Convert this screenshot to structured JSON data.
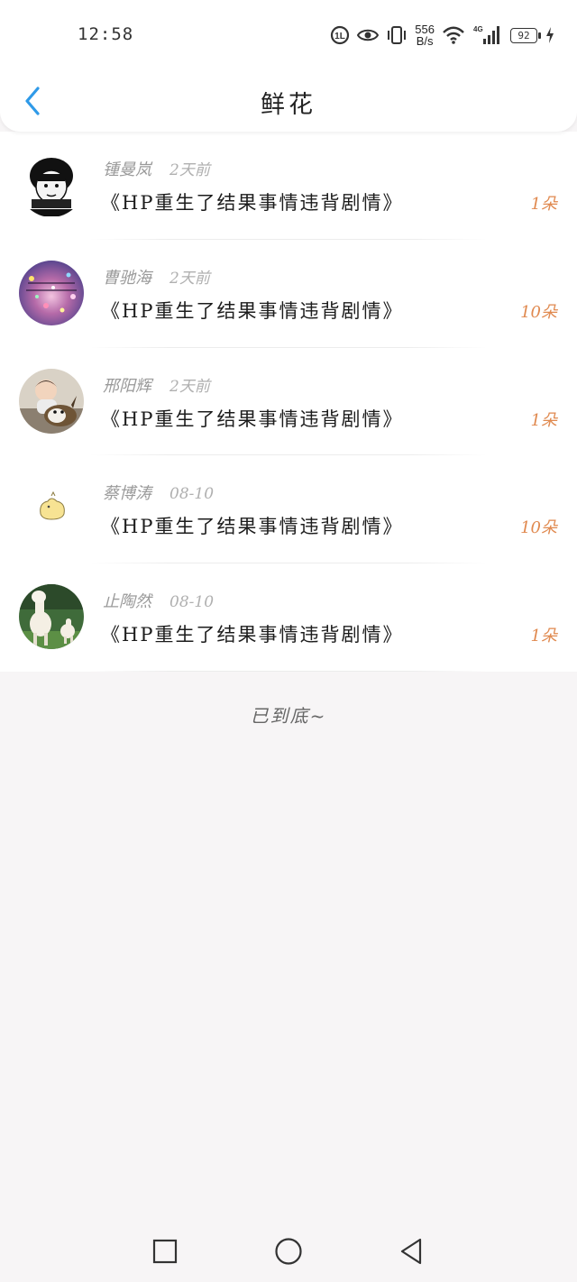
{
  "status_bar": {
    "time": "12:58",
    "net_speed_value": "556",
    "net_speed_unit": "B/s",
    "network_type": "4G",
    "battery_level": "92"
  },
  "header": {
    "title": "鲜花"
  },
  "list": {
    "items": [
      {
        "name": "锺曼岚",
        "time": "2天前",
        "title": "《HP重生了结果事情违背剧情》",
        "count": "1朵",
        "avatar": "meme-avatar"
      },
      {
        "name": "曹驰海",
        "time": "2天前",
        "title": "《HP重生了结果事情违背剧情》",
        "count": "10朵",
        "avatar": "glitter-avatar"
      },
      {
        "name": "邢阳辉",
        "time": "2天前",
        "title": "《HP重生了结果事情违背剧情》",
        "count": "1朵",
        "avatar": "child-dog-avatar"
      },
      {
        "name": "蔡博涛",
        "time": "08-10",
        "title": "《HP重生了结果事情违背剧情》",
        "count": "10朵",
        "avatar": "chick-avatar"
      },
      {
        "name": "止陶然",
        "time": "08-10",
        "title": "《HP重生了结果事情违背剧情》",
        "count": "1朵",
        "avatar": "alpaca-avatar"
      }
    ]
  },
  "footer": {
    "end_text": "已到底~"
  },
  "colors": {
    "accent": "#2f9ae8",
    "count": "#e0894f",
    "background": "#f7f5f6"
  }
}
